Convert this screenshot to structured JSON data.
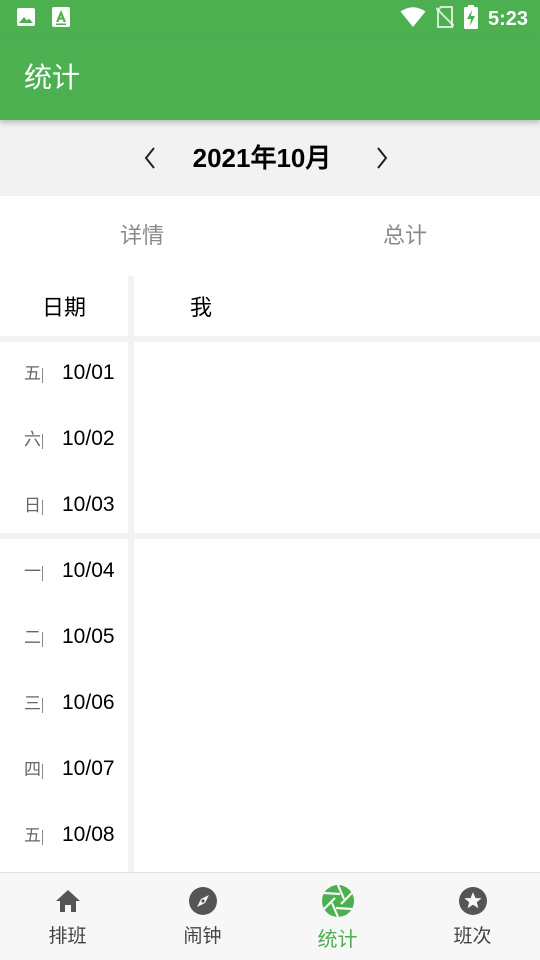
{
  "status_bar": {
    "time": "5:23"
  },
  "app_bar": {
    "title": "统计"
  },
  "month_nav": {
    "title": "2021年10月"
  },
  "tabs": [
    {
      "label": "详情"
    },
    {
      "label": "总计"
    }
  ],
  "table": {
    "col_date": "日期",
    "col_person": "我",
    "rows": [
      {
        "weekday": "五",
        "date": "10/01"
      },
      {
        "weekday": "六",
        "date": "10/02"
      },
      {
        "weekday": "日",
        "date": "10/03"
      },
      {
        "weekday": "一",
        "date": "10/04"
      },
      {
        "weekday": "二",
        "date": "10/05"
      },
      {
        "weekday": "三",
        "date": "10/06"
      },
      {
        "weekday": "四",
        "date": "10/07"
      },
      {
        "weekday": "五",
        "date": "10/08"
      }
    ]
  },
  "bottom_nav": {
    "items": [
      {
        "label": "排班",
        "icon": "home-icon"
      },
      {
        "label": "闹钟",
        "icon": "compass-icon"
      },
      {
        "label": "统计",
        "icon": "aperture-icon",
        "active": true
      },
      {
        "label": "班次",
        "icon": "star-circle-icon"
      }
    ]
  },
  "colors": {
    "primary": "#4caf50",
    "active_tab": "#4caf50",
    "inactive_label": "#444444"
  }
}
